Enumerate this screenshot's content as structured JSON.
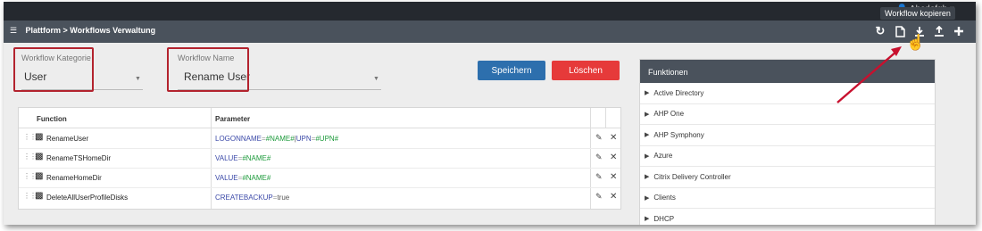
{
  "topbar": {
    "user_name": "Abcdefgh"
  },
  "tooltip": "Workflow kopieren",
  "breadcrumb": "Plattform > Workflows Verwaltung",
  "toolbar": {
    "refresh_icon": "refresh-icon",
    "copy_icon": "copy-icon",
    "download_icon": "download-icon",
    "upload_icon": "upload-icon",
    "add_icon": "plus-icon"
  },
  "form": {
    "category": {
      "label": "Workflow Kategorie",
      "value": "User"
    },
    "name": {
      "label": "Workflow Name",
      "value": "Rename User"
    }
  },
  "buttons": {
    "save": "Speichern",
    "delete": "Löschen"
  },
  "table": {
    "headers": [
      "Function",
      "Parameter"
    ],
    "rows": [
      {
        "function": "RenameUser",
        "params": [
          {
            "key": "LOGONNAME",
            "value": "#NAME#"
          },
          {
            "key": "UPN",
            "value": "#UPN#"
          }
        ]
      },
      {
        "function": "RenameTSHomeDir",
        "params": [
          {
            "key": "VALUE",
            "value": "#NAME#"
          }
        ]
      },
      {
        "function": "RenameHomeDir",
        "params": [
          {
            "key": "VALUE",
            "value": "#NAME#"
          }
        ]
      },
      {
        "function": "DeleteAllUserProfileDisks",
        "params": [
          {
            "key": "CREATEBACKUP",
            "value": "true"
          }
        ]
      }
    ]
  },
  "panel": {
    "title": "Funktionen",
    "items": [
      "Active Directory",
      "AHP One",
      "AHP Symphony",
      "Azure",
      "Citrix Delivery Controller",
      "Clients",
      "DHCP"
    ]
  },
  "colors": {
    "accent_red": "#b3232e",
    "save_blue": "#2d6fad",
    "delete_red": "#e63a3a",
    "header_gray": "#4a525c"
  }
}
